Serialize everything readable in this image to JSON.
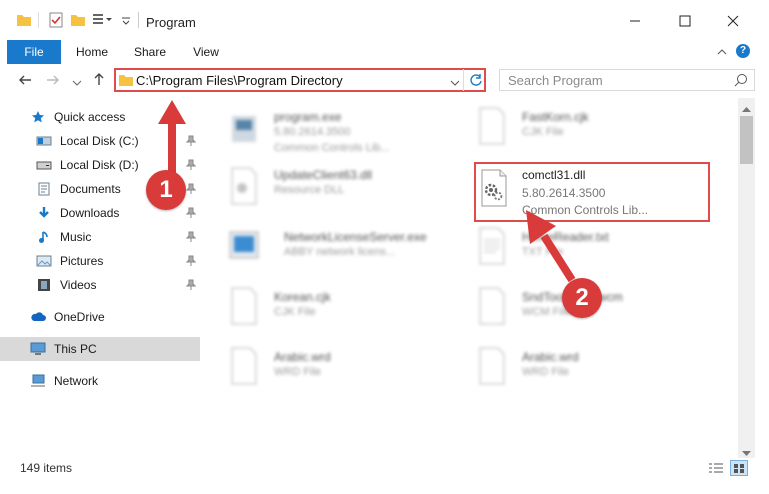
{
  "window": {
    "title": "Program"
  },
  "ribbon": {
    "tabs": [
      "File",
      "Home",
      "Share",
      "View"
    ]
  },
  "address": {
    "path": "C:\\Program Files\\Program Directory"
  },
  "search": {
    "placeholder": "Search Program"
  },
  "sidebar": {
    "items": [
      {
        "label": "Quick access"
      },
      {
        "label": "Local Disk (C:)"
      },
      {
        "label": "Local Disk (D:)"
      },
      {
        "label": "Documents"
      },
      {
        "label": "Downloads"
      },
      {
        "label": "Music"
      },
      {
        "label": "Pictures"
      },
      {
        "label": "Videos"
      },
      {
        "label": "OneDrive"
      },
      {
        "label": "This PC"
      },
      {
        "label": "Network"
      }
    ]
  },
  "files": [
    {
      "name": "program.exe",
      "line2": "5.80.2614.3500",
      "line3": "Common Controls Lib..."
    },
    {
      "name": "FastKorn.cjk",
      "line2": "CJK File"
    },
    {
      "name": "UpdateClient63.dll",
      "line2": "Resource DLL"
    },
    {
      "name": "comctl31.dll",
      "line2": "5.80.2614.3500",
      "line3": "Common Controls Lib..."
    },
    {
      "name": "NetworkLicenseServer.exe",
      "line2": "ABBY network licens..."
    },
    {
      "name": "HomeReader.txt",
      "line2": "TXT File"
    },
    {
      "name": "Korean.cjk",
      "line2": "CJK File"
    },
    {
      "name": "SndToolboxm.wcm",
      "line2": "WCM File"
    },
    {
      "name": "Arabic.wrd",
      "line2": "WRD File"
    },
    {
      "name": "Arabic.wrd",
      "line2": "WRD File"
    }
  ],
  "status": {
    "items": "149 items"
  },
  "annotations": {
    "step1": "1",
    "step2": "2"
  },
  "colors": {
    "accent": "#1979ca",
    "highlight": "#e04b4b",
    "badge": "#d93a3a"
  }
}
